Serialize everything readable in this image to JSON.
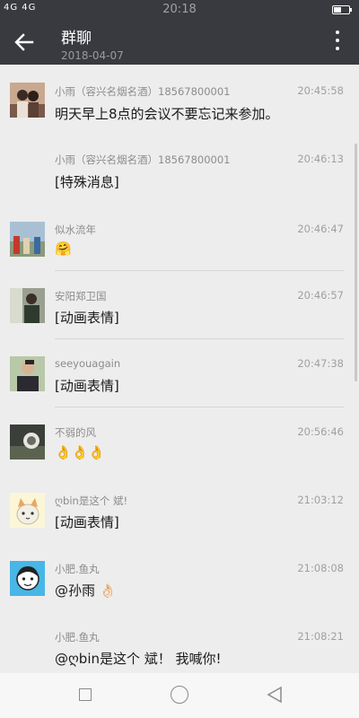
{
  "status_bar": {
    "signal": "4G 4G",
    "time": "20:18"
  },
  "header": {
    "title": "群聊",
    "date": "2018-04-07"
  },
  "messages": [
    {
      "sender": "小雨（容兴名烟名酒）18567800001",
      "time": "20:45:58",
      "content": "明天早上8点的会议不要忘记来参加。",
      "avatar": "photo"
    },
    {
      "sender": "小雨（容兴名烟名酒）18567800001",
      "time": "20:46:13",
      "content": "[特殊消息]",
      "avatar": "none"
    },
    {
      "sender": "似水流年",
      "time": "20:46:47",
      "content": "🤗",
      "avatar": "photo"
    },
    {
      "sender": "安阳郑卫国",
      "time": "20:46:57",
      "content": "[动画表情]",
      "avatar": "photo"
    },
    {
      "sender": "seeyouagain",
      "time": "20:47:38",
      "content": "[动画表情]",
      "avatar": "photo"
    },
    {
      "sender": "不弱的风",
      "time": "20:56:46",
      "content": "👌👌👌",
      "avatar": "photo"
    },
    {
      "sender": "ღbin是这个 斌!",
      "time": "21:03:12",
      "content": "[动画表情]",
      "avatar": "cat"
    },
    {
      "sender": "小肥.鱼丸",
      "time": "21:08:08",
      "content": "@孙雨 👌🏻",
      "avatar": "cartoon"
    },
    {
      "sender": "小肥.鱼丸",
      "time": "21:08:21",
      "content": "@ღbin是这个 斌！ 我喊你!",
      "avatar": "none"
    }
  ],
  "colors": {
    "header_bg": "#393a3f",
    "list_bg": "#ededed"
  }
}
